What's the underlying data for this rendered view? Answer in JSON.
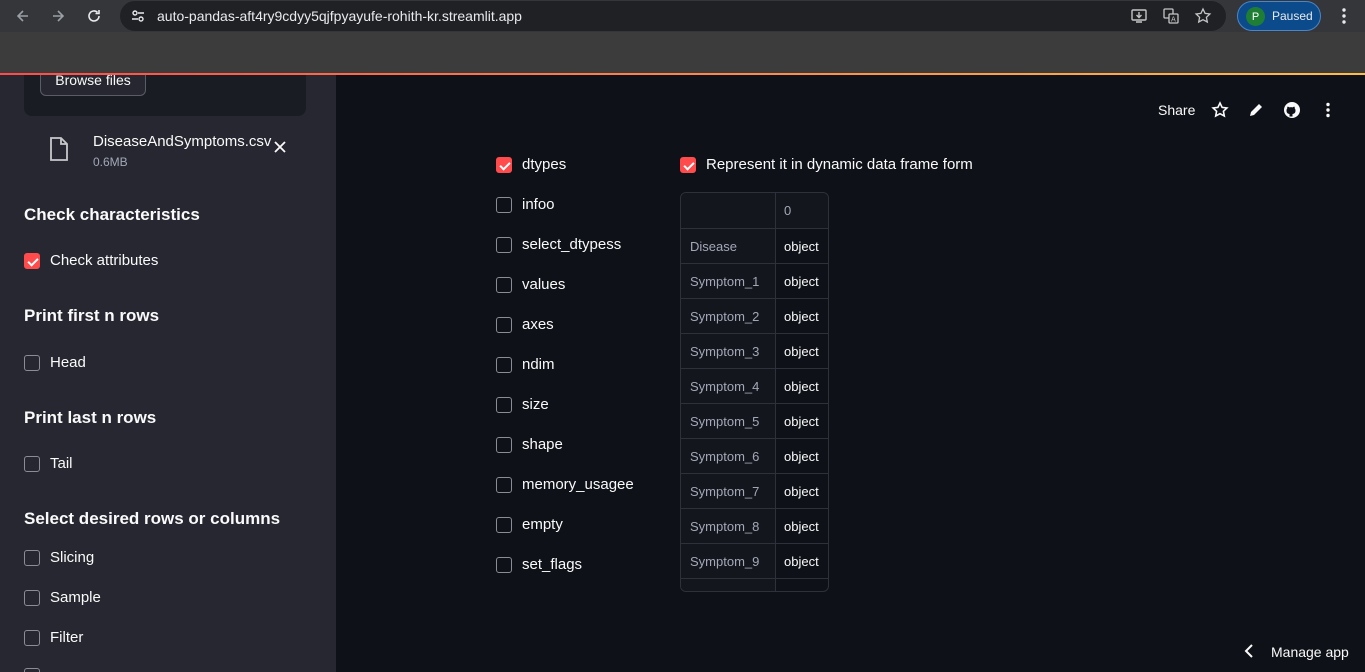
{
  "browser": {
    "url": "auto-pandas-aft4ry9cdyy5qjfpyayufe-rohith-kr.streamlit.app",
    "profile_initial": "P",
    "profile_status": "Paused"
  },
  "sidebar": {
    "browse_label": "Browse files",
    "file": {
      "name": "DiseaseAndSymptoms.csv",
      "size": "0.6MB"
    },
    "sections": [
      {
        "heading": "Check characteristics",
        "items": [
          {
            "label": "Check attributes",
            "checked": true
          }
        ]
      },
      {
        "heading": "Print first n rows",
        "items": [
          {
            "label": "Head",
            "checked": false
          }
        ]
      },
      {
        "heading": "Print last n rows",
        "items": [
          {
            "label": "Tail",
            "checked": false
          }
        ]
      },
      {
        "heading": "Select desired rows or columns",
        "items": [
          {
            "label": "Slicing",
            "checked": false
          },
          {
            "label": "Sample",
            "checked": false
          },
          {
            "label": "Filter",
            "checked": false
          }
        ]
      }
    ]
  },
  "header": {
    "share_label": "Share"
  },
  "attributes": [
    {
      "label": "dtypes",
      "checked": true
    },
    {
      "label": "infoo",
      "checked": false
    },
    {
      "label": "select_dtypess",
      "checked": false
    },
    {
      "label": "values",
      "checked": false
    },
    {
      "label": "axes",
      "checked": false
    },
    {
      "label": "ndim",
      "checked": false
    },
    {
      "label": "size",
      "checked": false
    },
    {
      "label": "shape",
      "checked": false
    },
    {
      "label": "memory_usagee",
      "checked": false
    },
    {
      "label": "empty",
      "checked": false
    },
    {
      "label": "set_flags",
      "checked": false
    }
  ],
  "dynamic_toggle": {
    "label": "Represent it in dynamic data frame form",
    "checked": true
  },
  "dataframe": {
    "column": "0",
    "rows": [
      {
        "index": "Disease",
        "value": "object"
      },
      {
        "index": "Symptom_1",
        "value": "object"
      },
      {
        "index": "Symptom_2",
        "value": "object"
      },
      {
        "index": "Symptom_3",
        "value": "object"
      },
      {
        "index": "Symptom_4",
        "value": "object"
      },
      {
        "index": "Symptom_5",
        "value": "object"
      },
      {
        "index": "Symptom_6",
        "value": "object"
      },
      {
        "index": "Symptom_7",
        "value": "object"
      },
      {
        "index": "Symptom_8",
        "value": "object"
      },
      {
        "index": "Symptom_9",
        "value": "object"
      }
    ]
  },
  "footer": {
    "manage_label": "Manage app"
  },
  "colors": {
    "accent": "#ff4b4b",
    "sidebar_bg": "#262730",
    "main_bg": "#0e1117"
  }
}
